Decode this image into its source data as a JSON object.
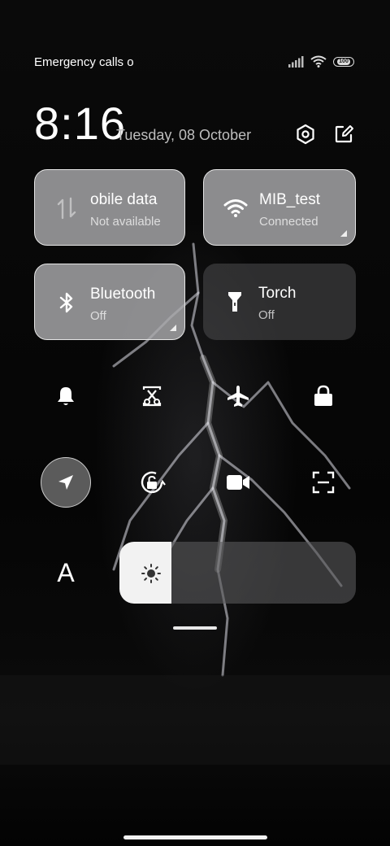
{
  "status_bar": {
    "carrier_text": "Emergency calls o",
    "battery_level": "100"
  },
  "header": {
    "time": "8:16",
    "date": "Tuesday, 08 October"
  },
  "tiles": [
    {
      "label": "obile data",
      "subtitle": "Not available",
      "active": true,
      "icon": "mobile-data-icon"
    },
    {
      "label": "MIB_test",
      "subtitle": "Connected",
      "active": true,
      "icon": "wifi-icon"
    },
    {
      "label": "Bluetooth",
      "subtitle": "Off",
      "active": true,
      "icon": "bluetooth-icon"
    },
    {
      "label": "Torch",
      "subtitle": "Off",
      "active": false,
      "icon": "torch-icon"
    }
  ],
  "toggles_row1": [
    "bell-icon",
    "screenshot-icon",
    "airplane-icon",
    "lock-icon"
  ],
  "toggles_row2": [
    "location-icon",
    "rotation-lock-icon",
    "video-camera-icon",
    "scan-icon"
  ],
  "brightness": {
    "font_label": "A",
    "level": 0.22
  },
  "colors": {
    "active_tile": "#aaaaac",
    "inactive_tile": "#4e4e50",
    "slider_fill": "#f2f2f2"
  }
}
